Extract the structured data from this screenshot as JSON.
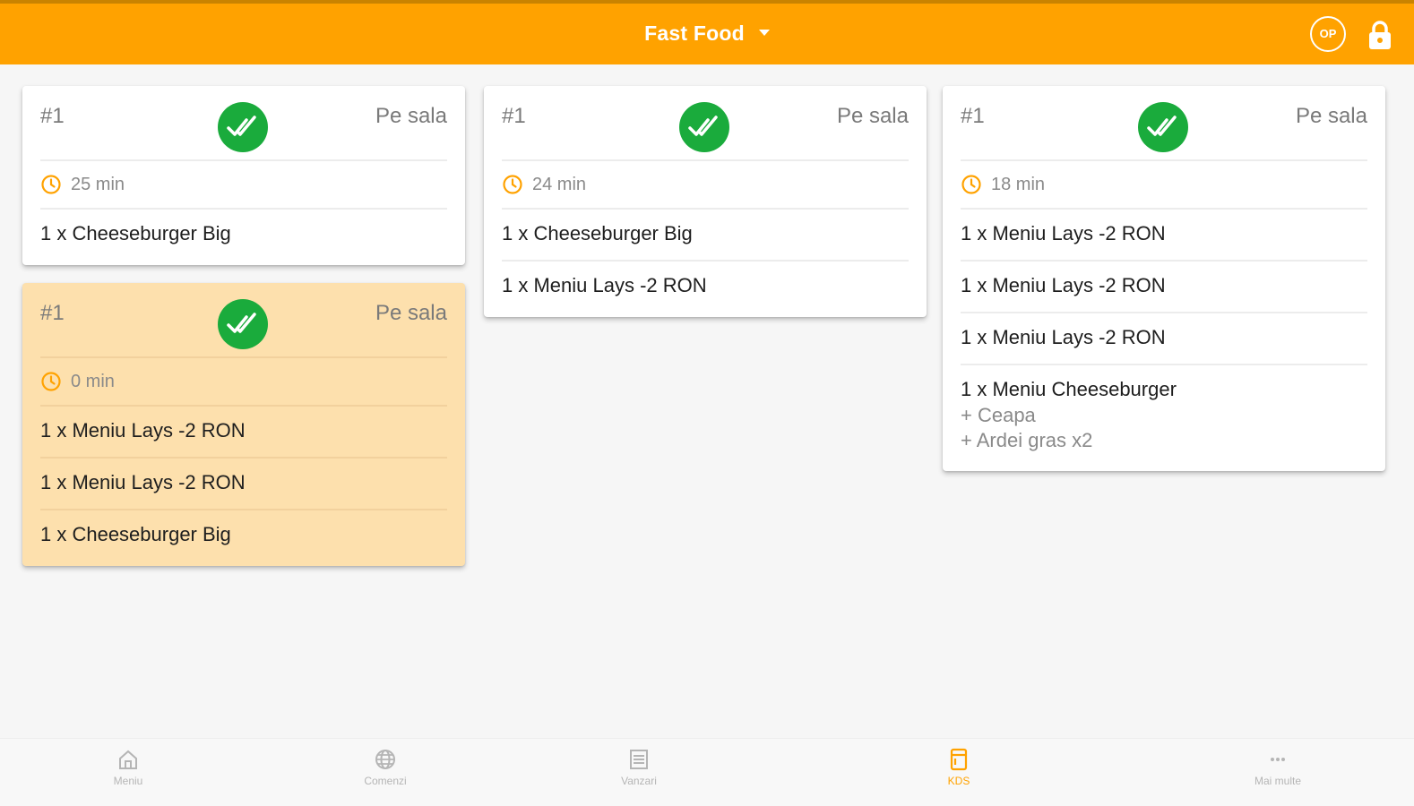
{
  "topbar": {
    "title": "Fast Food",
    "operator_badge": "OP",
    "icons": {
      "dropdown": "caret-down-icon",
      "lock": "lock-icon"
    },
    "colors": {
      "background": "#ffa200",
      "text": "#ffffff"
    }
  },
  "colors": {
    "status_ok": "#1aab3c",
    "highlight_card": "#fde0ad",
    "accent": "#ffa200"
  },
  "columns": [
    {
      "cards": [
        {
          "order": "#1",
          "location": "Pe sala",
          "time": "25 min",
          "highlight": false,
          "items": [
            {
              "text": "1 x Cheeseburger Big"
            }
          ]
        },
        {
          "order": "#1",
          "location": "Pe sala",
          "time": "0 min",
          "highlight": true,
          "items": [
            {
              "text": "1 x Meniu Lays -2 RON"
            },
            {
              "text": "1 x Meniu Lays -2 RON"
            },
            {
              "text": "1 x Cheeseburger Big"
            }
          ]
        }
      ]
    },
    {
      "cards": [
        {
          "order": "#1",
          "location": "Pe sala",
          "time": "24 min",
          "highlight": false,
          "items": [
            {
              "text": "1 x Cheeseburger Big"
            },
            {
              "text": "1 x Meniu Lays -2 RON"
            }
          ]
        }
      ]
    },
    {
      "cards": [
        {
          "order": "#1",
          "location": "Pe sala",
          "time": "18 min",
          "highlight": false,
          "items": [
            {
              "text": "1 x Meniu Lays -2 RON"
            },
            {
              "text": "1 x Meniu Lays -2 RON"
            },
            {
              "text": "1 x Meniu Lays -2 RON"
            },
            {
              "text": "1 x Meniu Cheeseburger",
              "modifiers": [
                "+ Ceapa",
                "+ Ardei gras x2"
              ]
            }
          ]
        }
      ]
    }
  ],
  "bottom_nav": [
    {
      "label": "Meniu",
      "icon": "home-icon",
      "active": false
    },
    {
      "label": "Comenzi",
      "icon": "globe-icon",
      "active": false
    },
    {
      "label": "Vanzari",
      "icon": "receipt-icon",
      "active": false
    },
    {
      "label": "KDS",
      "icon": "kds-icon",
      "active": true
    },
    {
      "label": "Mai multe",
      "icon": "more-icon",
      "active": false
    }
  ]
}
